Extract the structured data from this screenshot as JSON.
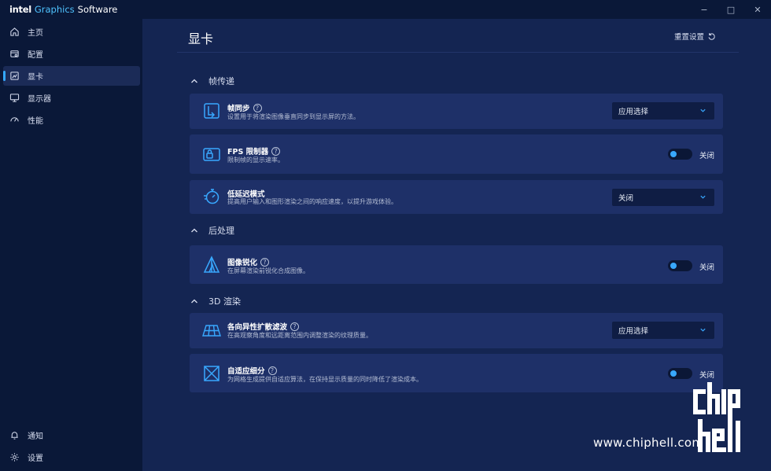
{
  "titlebar": {
    "brand_intel": "intel",
    "brand_graphics": "Graphics",
    "brand_software": "Software",
    "minimize": "−",
    "maximize": "□",
    "close": "✕"
  },
  "sidebar": {
    "items": [
      {
        "label": "主页",
        "icon": "home-icon"
      },
      {
        "label": "配置",
        "icon": "profile-icon"
      },
      {
        "label": "显卡",
        "icon": "graphics-icon",
        "active": true
      },
      {
        "label": "显示器",
        "icon": "monitor-icon"
      },
      {
        "label": "性能",
        "icon": "performance-icon"
      }
    ],
    "bottom": [
      {
        "label": "通知",
        "icon": "bell-icon"
      },
      {
        "label": "设置",
        "icon": "gear-icon"
      }
    ]
  },
  "main": {
    "title": "显卡",
    "reset_label": "重置设置",
    "sections": [
      {
        "title": "帧传递"
      },
      {
        "title": "后处理"
      },
      {
        "title": "3D 渲染"
      }
    ],
    "cards": [
      {
        "title": "帧同步",
        "desc": "设置用于将渲染图像垂直同步到显示屏的方法。",
        "control": "select",
        "value": "应用选择"
      },
      {
        "title": "FPS 限制器",
        "desc": "限制帧的显示速率。",
        "control": "toggle",
        "value": "关闭"
      },
      {
        "title": "低延迟模式",
        "desc": "提高用户输入和图形渲染之间的响应速度，以提升游戏体验。",
        "control": "select",
        "value": "关闭"
      },
      {
        "title": "图像锐化",
        "desc": "在屏幕渲染前锐化合成图像。",
        "control": "toggle",
        "value": "关闭"
      },
      {
        "title": "各向异性扩散滤波",
        "desc": "在高观察角度和远距离范围内调整渲染的纹理质量。",
        "control": "select",
        "value": "应用选择"
      },
      {
        "title": "自适应细分",
        "desc": "为网格生成提供自适应算法，在保持显示质量的同时降低了渲染成本。",
        "control": "toggle",
        "value": "关闭"
      }
    ]
  },
  "watermark": {
    "text": "www.chiphell.com",
    "logo": "chiphell"
  },
  "colors": {
    "accent": "#38a8ff",
    "background": "#142552",
    "card": "#1e3068",
    "sidebar": "#0a1838"
  }
}
